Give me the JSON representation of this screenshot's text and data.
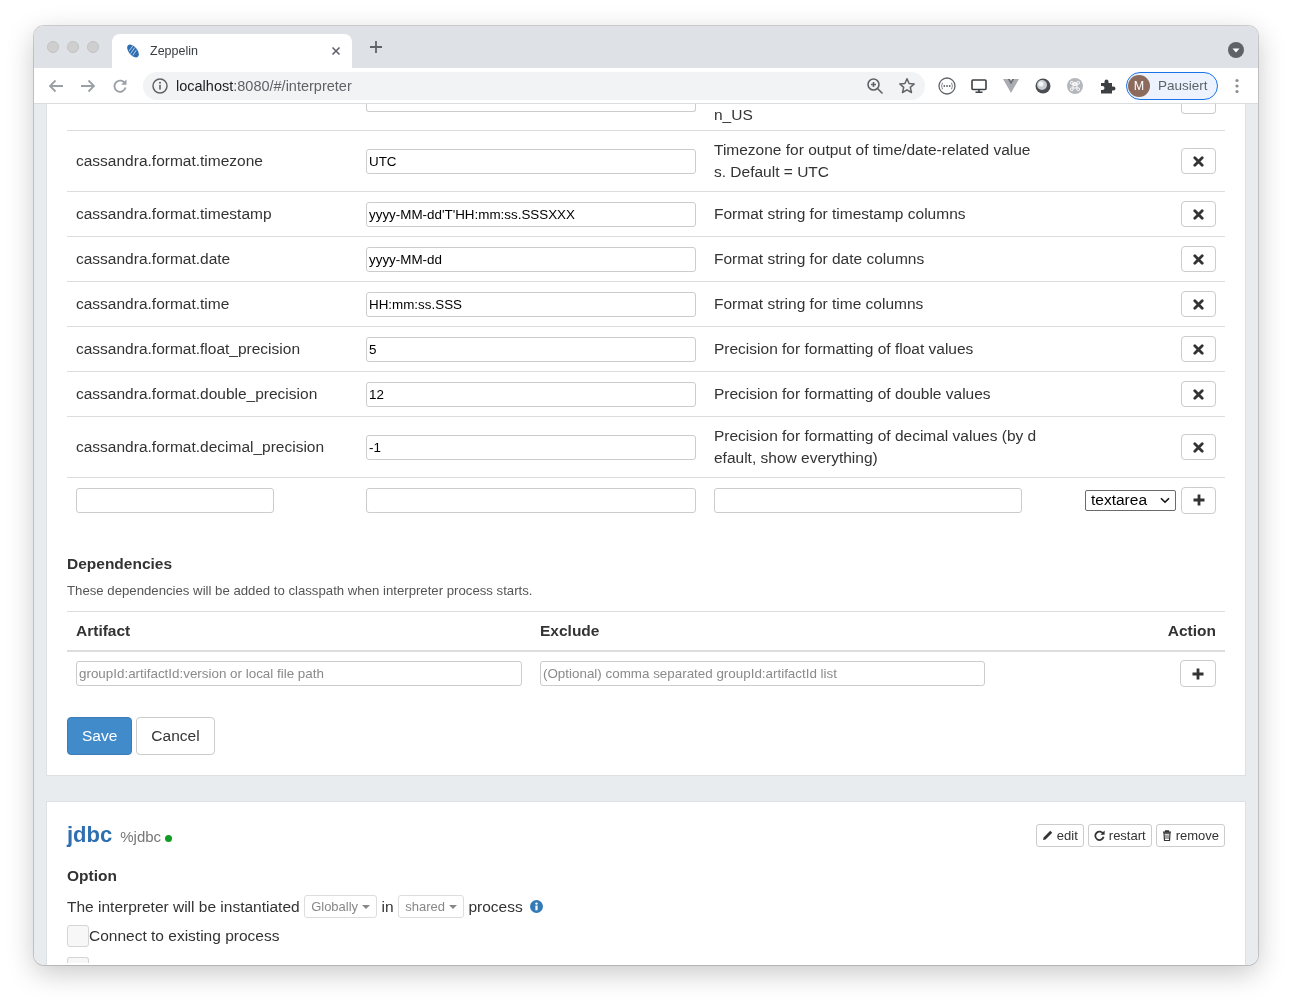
{
  "browser": {
    "tabs": [
      {
        "title": "Zeppelin",
        "selected": true
      }
    ],
    "url": {
      "host": "localhost",
      "path": ":8080/#/interpreter"
    },
    "profile": {
      "initial": "M",
      "label": "Pausiert"
    }
  },
  "properties": {
    "clipped_row": {
      "description": "n_US"
    },
    "rows": [
      {
        "name": "cassandra.format.timezone",
        "value": "UTC",
        "description": "Timezone for output of time/date-related values. Default = UTC"
      },
      {
        "name": "cassandra.format.timestamp",
        "value": "yyyy-MM-dd'T'HH:mm:ss.SSSXXX",
        "description": "Format string for timestamp columns"
      },
      {
        "name": "cassandra.format.date",
        "value": "yyyy-MM-dd",
        "description": "Format string for date columns"
      },
      {
        "name": "cassandra.format.time",
        "value": "HH:mm:ss.SSS",
        "description": "Format string for time columns"
      },
      {
        "name": "cassandra.format.float_precision",
        "value": "5",
        "description": "Precision for formatting of float values"
      },
      {
        "name": "cassandra.format.double_precision",
        "value": "12",
        "description": "Precision for formatting of double values"
      },
      {
        "name": "cassandra.format.decimal_precision",
        "value": "-1",
        "description": "Precision for formatting of decimal values (by default, show everything)"
      }
    ],
    "new_row": {
      "type": "textarea"
    }
  },
  "dependencies": {
    "title": "Dependencies",
    "note": "These dependencies will be added to classpath when interpreter process starts.",
    "columns": [
      "Artifact",
      "Exclude",
      "Action"
    ],
    "artifact_placeholder": "groupId:artifactId:version or local file path",
    "exclude_placeholder": "(Optional) comma separated groupId:artifactId list"
  },
  "form_buttons": [
    {
      "label": "Save",
      "kind": "primary"
    },
    {
      "label": "Cancel",
      "kind": "default"
    }
  ],
  "interpreter": {
    "name": "jdbc",
    "alias": "%jdbc",
    "running": true,
    "actions": [
      {
        "label": "edit",
        "kind": "edit"
      },
      {
        "label": "restart",
        "kind": "restart"
      },
      {
        "label": "remove",
        "kind": "remove"
      }
    ],
    "option_title": "Option",
    "instantiation": {
      "prefix": "The interpreter will be instantiated",
      "scope": "Globally",
      "joiner": "in",
      "mode": "shared",
      "suffix": "process"
    },
    "options": [
      {
        "label": "Connect to existing process",
        "checked": false
      },
      {
        "checked": false
      }
    ]
  }
}
